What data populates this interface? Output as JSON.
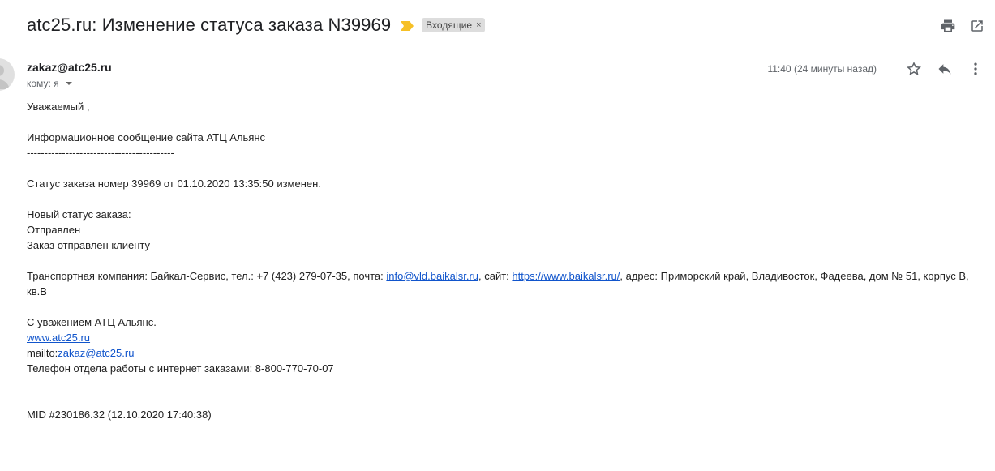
{
  "email": {
    "subject": "atc25.ru: Изменение статуса заказа N39969",
    "label": "Входящие",
    "label_remove": "×",
    "sender": "zakaz@atc25.ru",
    "to_label": "кому: я",
    "time": "11:40 (24 минуты назад)"
  },
  "body": {
    "greeting": "Уважаемый ,",
    "info": "Информационное сообщение сайта АТЦ Альянс",
    "separator": "------------------------------------------",
    "status_line": "Статус заказа номер 39969 от 01.10.2020 13:35:50 изменен.",
    "new_status_label": "Новый статус заказа:",
    "status_value": "Отправлен",
    "status_desc": "Заказ отправлен клиенту",
    "transport_prefix": "Транспортная компания: Байкал-Сервис, тел.: +7 (423) 279-07-35, почта: ",
    "transport_email": "info@vld.baikalsr.ru",
    "transport_site_prefix": ", сайт: ",
    "transport_site": "https://www.baikalsr.ru/",
    "transport_address": ", адрес: Приморский край, Владивосток, Фадеева, дом № 51, корпус В, кв.В",
    "regards": "С уважением  АТЦ Альянс.",
    "site_link": "www.atc25.ru",
    "mailto_prefix": "mailto:",
    "mailto_link": "zakaz@atc25.ru",
    "phone_line": "Телефон отдела работы с интернет заказами: 8-800-770-70-07",
    "mid": "MID #230186.32 (12.10.2020 17:40:38)"
  },
  "icons": {
    "print": "print-icon",
    "open_new_window": "open-in-new-window-icon",
    "star": "star-icon",
    "reply": "reply-icon",
    "more": "more-vert-icon",
    "importance": "importance-marker-icon",
    "avatar": "avatar"
  },
  "colors": {
    "link": "#1155cc",
    "importance": "#f6c026",
    "label_bg": "#dddddd",
    "secondary_text": "#5f6368"
  }
}
